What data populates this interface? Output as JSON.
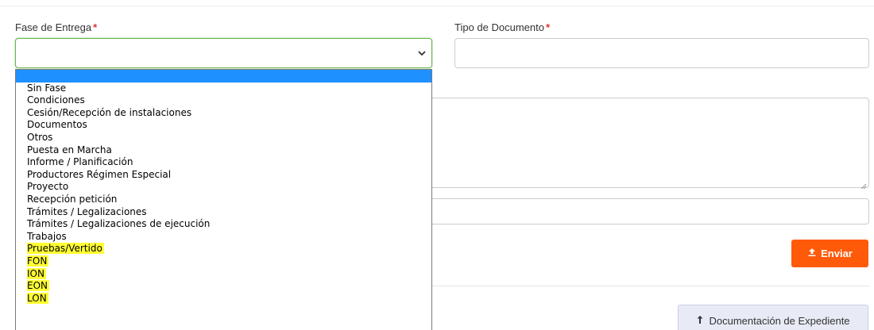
{
  "form": {
    "fase_label": "Fase de Entrega",
    "tipo_label": "Tipo de Documento",
    "required_mark": "*",
    "fase_value": "",
    "tipo_value": ""
  },
  "dropdown": {
    "options": [
      {
        "label": "",
        "selected": true,
        "highlighted": false
      },
      {
        "label": "Sin Fase",
        "selected": false,
        "highlighted": false
      },
      {
        "label": "Condiciones",
        "selected": false,
        "highlighted": false
      },
      {
        "label": "Cesión/Recepción de instalaciones",
        "selected": false,
        "highlighted": false
      },
      {
        "label": "Documentos",
        "selected": false,
        "highlighted": false
      },
      {
        "label": "Otros",
        "selected": false,
        "highlighted": false
      },
      {
        "label": "Puesta en Marcha",
        "selected": false,
        "highlighted": false
      },
      {
        "label": "Informe / Planificación",
        "selected": false,
        "highlighted": false
      },
      {
        "label": "Productores Régimen Especial",
        "selected": false,
        "highlighted": false
      },
      {
        "label": "Proyecto",
        "selected": false,
        "highlighted": false
      },
      {
        "label": "Recepción petición",
        "selected": false,
        "highlighted": false
      },
      {
        "label": "Trámites / Legalizaciones",
        "selected": false,
        "highlighted": false
      },
      {
        "label": "Trámites / Legalizaciones de ejecución",
        "selected": false,
        "highlighted": false
      },
      {
        "label": "Trabajos",
        "selected": false,
        "highlighted": false
      },
      {
        "label": "Pruebas/Vertido",
        "selected": false,
        "highlighted": true
      },
      {
        "label": "FON",
        "selected": false,
        "highlighted": true
      },
      {
        "label": "ION",
        "selected": false,
        "highlighted": true
      },
      {
        "label": "EON",
        "selected": false,
        "highlighted": true
      },
      {
        "label": "LON",
        "selected": false,
        "highlighted": true
      }
    ]
  },
  "buttons": {
    "enviar_label": "Enviar",
    "doc_label": "Documentación de Expediente"
  },
  "icons": {
    "enviar": "upload-icon",
    "doc": "upload-arrow-icon",
    "select": "chevron-down-icon"
  },
  "colors": {
    "accent": "#ff5a0a",
    "focus_border": "#66b34c",
    "selection": "#1e90ff",
    "highlight": "#ffff33",
    "required": "#d9342b"
  }
}
